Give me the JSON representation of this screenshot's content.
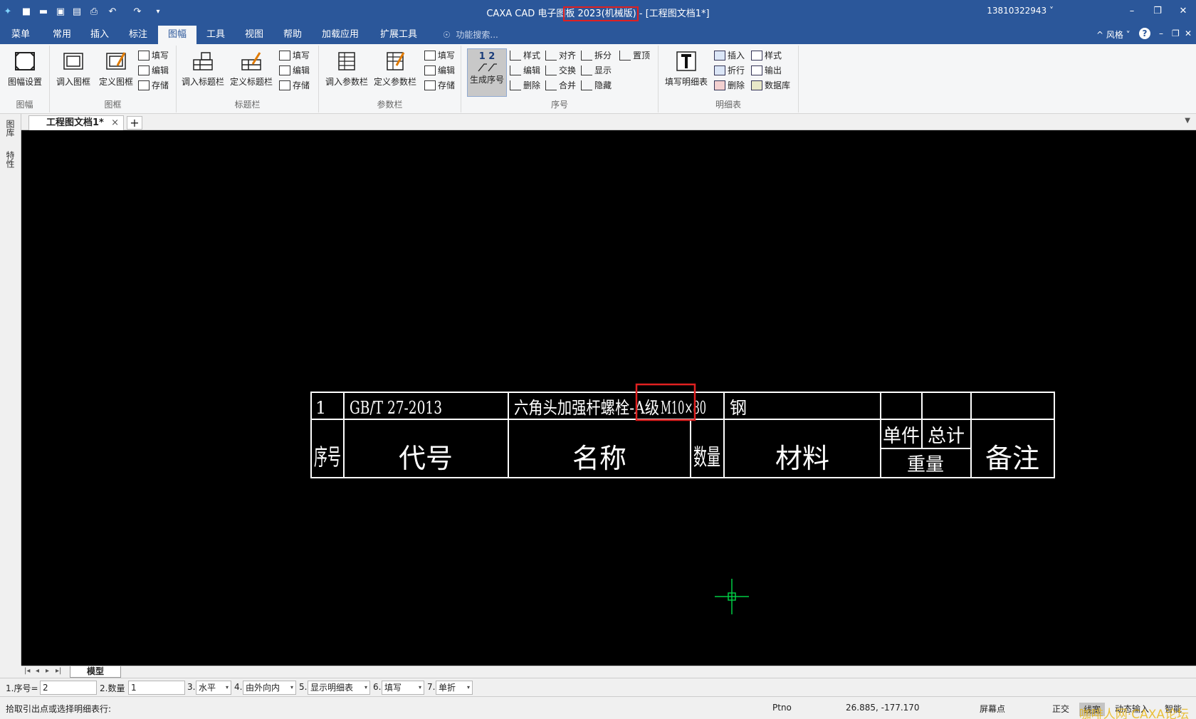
{
  "titlebar": {
    "quick_access": [
      {
        "name": "app-logo-icon",
        "glyph": "✦"
      },
      {
        "name": "new-file-icon",
        "glyph": "■"
      },
      {
        "name": "open-folder-icon",
        "glyph": "▬"
      },
      {
        "name": "save-icon",
        "glyph": "▣"
      },
      {
        "name": "save-all-icon",
        "glyph": "▤"
      },
      {
        "name": "print-icon",
        "glyph": "⎙"
      },
      {
        "name": "undo-icon",
        "glyph": "↶"
      },
      {
        "name": "redo-icon",
        "glyph": "↷"
      },
      {
        "name": "customize-qat-icon",
        "glyph": "▾"
      }
    ],
    "title_prefix": "CAXA CAD 电子图",
    "title_highlight": "板 2023(机械版)",
    "title_suffix": " - [工程图文档1*]",
    "user": "13810322943 ˅",
    "minimize": "–",
    "restore": "❐",
    "close": "✕"
  },
  "tabs": {
    "items": [
      "菜单",
      "常用",
      "插入",
      "标注",
      "图幅",
      "工具",
      "视图",
      "帮助",
      "加载应用",
      "扩展工具"
    ],
    "active_index": 4,
    "search_placeholder": "功能搜索...",
    "style_label": "^ 风格 ˅",
    "help_glyph": "?",
    "inner_min": "–",
    "inner_restore": "❐",
    "inner_close": "✕"
  },
  "ribbon": {
    "group_tufu": {
      "label": "图幅",
      "btn": "图幅设置"
    },
    "group_tukuang": {
      "label": "图框",
      "btn1": "调入图框",
      "btn2": "定义图框",
      "s1": "填写",
      "s2": "编辑",
      "s3": "存储"
    },
    "group_biaoti": {
      "label": "标题栏",
      "btn1": "调入标题栏",
      "btn2": "定义标题栏",
      "s1": "填写",
      "s2": "编辑",
      "s3": "存储"
    },
    "group_canshu": {
      "label": "参数栏",
      "btn1": "调入参数栏",
      "btn2": "定义参数栏",
      "s1": "填写",
      "s2": "编辑",
      "s3": "存储"
    },
    "group_xuhao": {
      "label": "序号",
      "btn": "生成序号",
      "btn_top": "1 2",
      "s1": "样式",
      "s2": "编辑",
      "s3": "删除",
      "s4": "对齐",
      "s5": "交换",
      "s6": "合并",
      "s7": "拆分",
      "s8": "显示",
      "s9": "隐藏",
      "s10": "置顶"
    },
    "group_mingxi": {
      "label": "明细表",
      "btn": "填写明细表",
      "s1": "插入",
      "s2": "折行",
      "s3": "删除",
      "s4": "样式",
      "s5": "输出",
      "s6": "数据库"
    }
  },
  "doc": {
    "tab_label": "工程图文档1*",
    "close_glyph": "×",
    "add_glyph": "+",
    "dropdown_glyph": "▼"
  },
  "leftbar": {
    "tab1": "图库",
    "tab2": "特性"
  },
  "bom": {
    "row1": [
      "1",
      "GB/T 27-2013",
      "六角头加强杆螺栓-A级",
      "M10×80",
      "",
      "钢",
      "",
      "",
      ""
    ],
    "headers": [
      "序号",
      "代号",
      "名称",
      "数量",
      "材料",
      "单件",
      "总计",
      "重量",
      "备注"
    ]
  },
  "model": {
    "nav": [
      "|◂",
      "◂",
      "▸",
      "▸|"
    ],
    "tab": "模型"
  },
  "cmd": {
    "f1_label": "1.序号=",
    "f1_value": "2",
    "f2_label": "2.数量",
    "f2_value": "1",
    "f3_label": "3.",
    "f3_value": "水平",
    "f4_label": "4.",
    "f4_value": "由外向内",
    "f5_label": "5.",
    "f5_value": "显示明细表",
    "f6_label": "6.",
    "f6_value": "填写",
    "f7_label": "7.",
    "f7_value": "单折",
    "arrow": "▾"
  },
  "status": {
    "prompt": "拾取引出点或选择明细表行:",
    "mode": "Ptno",
    "coords": "26.885, -177.170",
    "snap": "屏幕点",
    "ortho": "正交",
    "linewidth": "线宽",
    "dynamic": "动态输入",
    "smart": "智能",
    "watermark": "咖啡人网·CAXA论坛"
  },
  "colors": {
    "accent": "#2b579a",
    "highlight_red": "#e02020",
    "canvas": "#000000",
    "cursor": "#00cc44"
  }
}
